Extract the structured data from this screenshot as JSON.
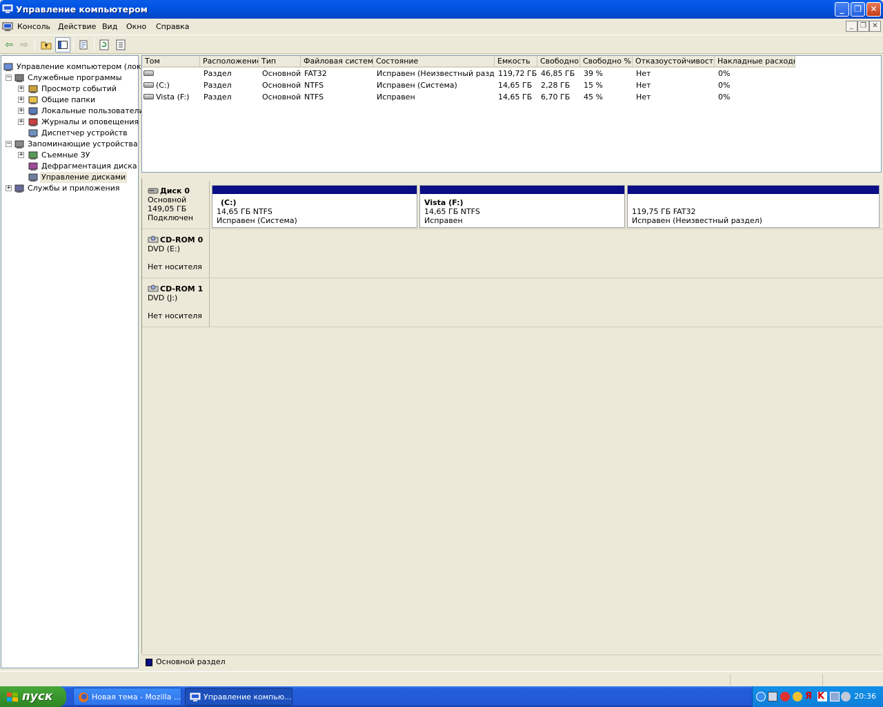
{
  "window": {
    "title": "Управление компьютером"
  },
  "menu": {
    "items": [
      "Консоль",
      "Действие",
      "Вид",
      "Окно",
      "Справка"
    ]
  },
  "tree": {
    "items": [
      {
        "label": "Управление компьютером (локаль",
        "level": 0,
        "expander": "",
        "icon": "computer-management-icon"
      },
      {
        "label": "Служебные программы",
        "level": 1,
        "expander": "−",
        "icon": "system-tools-icon"
      },
      {
        "label": "Просмотр событий",
        "level": 2,
        "expander": "+",
        "icon": "event-viewer-icon"
      },
      {
        "label": "Общие папки",
        "level": 2,
        "expander": "+",
        "icon": "shared-folders-icon"
      },
      {
        "label": "Локальные пользователи и",
        "level": 2,
        "expander": "+",
        "icon": "local-users-icon"
      },
      {
        "label": "Журналы и оповещения пр",
        "level": 2,
        "expander": "+",
        "icon": "performance-logs-icon"
      },
      {
        "label": "Диспетчер устройств",
        "level": 2,
        "expander": "",
        "icon": "device-manager-icon"
      },
      {
        "label": "Запоминающие устройства",
        "level": 1,
        "expander": "−",
        "icon": "storage-icon"
      },
      {
        "label": "Съемные ЗУ",
        "level": 2,
        "expander": "+",
        "icon": "removable-storage-icon"
      },
      {
        "label": "Дефрагментация диска",
        "level": 2,
        "expander": "",
        "icon": "defrag-icon"
      },
      {
        "label": "Управление дисками",
        "level": 2,
        "expander": "",
        "icon": "disk-management-icon",
        "selected": true
      },
      {
        "label": "Службы и приложения",
        "level": 1,
        "expander": "+",
        "icon": "services-icon"
      }
    ]
  },
  "volumes": {
    "columns": [
      "Том",
      "Расположение",
      "Тип",
      "Файловая система",
      "Состояние",
      "Емкость",
      "Свободно",
      "Свободно %",
      "Отказоустойчивость",
      "Накладные расходы"
    ],
    "rows": [
      [
        "",
        "Раздел",
        "Основной",
        "FAT32",
        "Исправен (Неизвестный раздел)",
        "119,72 ГБ",
        "46,85 ГБ",
        "39 %",
        "Нет",
        "0%"
      ],
      [
        "(C:)",
        "Раздел",
        "Основной",
        "NTFS",
        "Исправен (Система)",
        "14,65 ГБ",
        "2,28 ГБ",
        "15 %",
        "Нет",
        "0%"
      ],
      [
        "Vista (F:)",
        "Раздел",
        "Основной",
        "NTFS",
        "Исправен",
        "14,65 ГБ",
        "6,70 ГБ",
        "45 %",
        "Нет",
        "0%"
      ]
    ]
  },
  "disks": [
    {
      "name": "Диск 0",
      "type": "Основной",
      "size": "149,05 ГБ",
      "status": "Подключен",
      "partitions": [
        {
          "title": "(C:)",
          "size": "14,65 ГБ NTFS",
          "status": "Исправен (Система)"
        },
        {
          "title": "Vista  (F:)",
          "size": "14,65 ГБ NTFS",
          "status": "Исправен"
        },
        {
          "title": "",
          "size": "119,75 ГБ FAT32",
          "status": "Исправен (Неизвестный раздел)"
        }
      ]
    },
    {
      "name": "CD-ROM 0",
      "type": "DVD (E:)",
      "size": "",
      "status": "Нет носителя",
      "partitions": []
    },
    {
      "name": "CD-ROM 1",
      "type": "DVD (J:)",
      "size": "",
      "status": "Нет носителя",
      "partitions": []
    }
  ],
  "legend": {
    "label": "Основной раздел",
    "color": "#0a0d85"
  },
  "taskbar": {
    "start": "пуск",
    "tasks": [
      {
        "label": "Новая тема - Mozilla ...",
        "icon": "firefox-icon"
      },
      {
        "label": "Управление компью...",
        "icon": "computer-management-icon",
        "active": true
      }
    ],
    "clock": "20:36"
  }
}
